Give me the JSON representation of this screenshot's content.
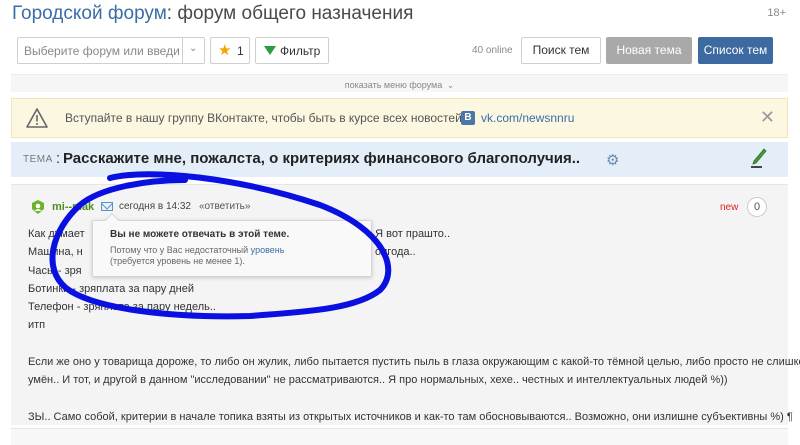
{
  "header": {
    "brand": "Городской форум",
    "sep": ":",
    "subtitle": "форум общего назначения",
    "age": "18+"
  },
  "toolbar": {
    "forum_select_placeholder": "Выберите форум или введи",
    "favorites_count": "1",
    "filter_label": "Фильтр",
    "online": "40 online",
    "search_label": "Поиск тем",
    "new_topic_label": "Новая тема",
    "topic_list_label": "Список тем"
  },
  "menu_toggle": "показать меню форума",
  "notice": {
    "text": "Вступайте в нашу группу ВКонтакте, чтобы быть в курсе всех новостей.",
    "vk_badge": "B",
    "link": "vk.com/newsnnru"
  },
  "topic": {
    "tag": "ТЕМА",
    "colon": ":",
    "title": "Расскажите мне, пожалста, о критериях финансового благополучия.."
  },
  "post": {
    "author": "mi--mak",
    "date": "сегодня в 14:32",
    "reply": "«ответить»",
    "new": "new",
    "count": "0",
    "lines": [
      "Как думает",
      "Машина, н",
      "Часы - зря",
      "Ботинки - зряплата за пару дней",
      "Телефон - зряплата за пару недель..",
      "итп",
      "",
      "Если же оно у товарища дороже, то либо он жулик, либо пытается пустить пыль в глаза окружающим с какой-то тёмной целью, либо просто не слишком",
      "умён.. И тот, и другой в данном \"исследовании\" не рассматриваются.. Я про нормальных, хехе.. честных и интеллектуальных людей %))",
      "",
      "ЗЫ.. Само собой, критерии в начале топика взяты из открытых источников и как-то там обосновываются.. Возможно, они излишне субъективны %) ¶"
    ],
    "line1_tail": "? Я вот прашто..",
    "line2_tail": "олгода.."
  },
  "tooltip": {
    "title": "Вы не можете отвечать в этой теме.",
    "reason_prefix": "Потому что у Вас недостаточный ",
    "reason_link": "уровень",
    "reason_suffix": "(требуется уровень не менее 1)."
  },
  "colors": {
    "brand": "#3a6ea5",
    "primary_button": "#3d6aa0",
    "disabled_button": "#a9a9a9",
    "notice_bg": "#fbf7e0",
    "topic_bar_bg": "#e3eef8",
    "author": "#4c8c23",
    "new_label": "#e02020",
    "scribble": "#0a10e0"
  },
  "icons": [
    "star-icon",
    "filter-icon",
    "warning-icon",
    "vk-icon",
    "close-icon",
    "gear-icon",
    "pen-icon",
    "avatar-icon",
    "mail-icon",
    "chevron-down-icon"
  ]
}
